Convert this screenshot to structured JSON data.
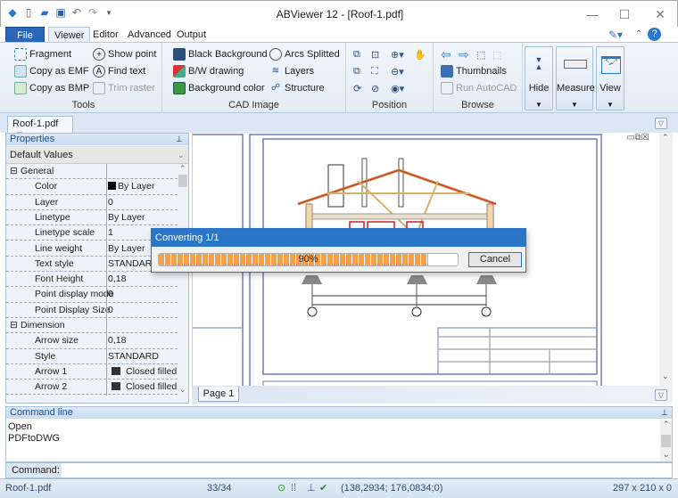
{
  "window": {
    "title": "ABViewer 12 - [Roof-1.pdf]",
    "minimize": "—",
    "maximize": "☐",
    "close": "✕"
  },
  "ribbon_tabs": [
    "File",
    "Viewer",
    "Editor",
    "Advanced",
    "Output"
  ],
  "ribbon": {
    "tools": {
      "label": "Tools",
      "items": [
        "Fragment",
        "Copy as EMF",
        "Copy as BMP",
        "Show point",
        "Find text",
        "Trim raster"
      ]
    },
    "cad_image": {
      "label": "CAD Image",
      "items": [
        "Black Background",
        "B/W drawing",
        "Background color",
        "Arcs Splitted",
        "Layers",
        "Structure"
      ]
    },
    "position": {
      "label": "Position"
    },
    "browse": {
      "label": "Browse",
      "items": [
        "Thumbnails",
        "Run AutoCAD"
      ]
    },
    "big_buttons": [
      "Hide",
      "Measure",
      "View"
    ]
  },
  "document_tab": "Roof-1.pdf",
  "properties": {
    "title": "Properties",
    "combo": "Default Values",
    "rows": [
      {
        "cat": true,
        "name": "General",
        "value": ""
      },
      {
        "name": "Color",
        "value": "By Layer"
      },
      {
        "name": "Layer",
        "value": "0"
      },
      {
        "name": "Linetype",
        "value": "By Layer"
      },
      {
        "name": "Linetype scale",
        "value": "1"
      },
      {
        "name": "Line weight",
        "value": "By Layer"
      },
      {
        "name": "Text style",
        "value": "STANDARD"
      },
      {
        "name": "Font Height",
        "value": "0,18"
      },
      {
        "name": "Point display mode",
        "value": "0"
      },
      {
        "name": "Point Display Size",
        "value": "0"
      },
      {
        "cat": true,
        "name": "Dimension",
        "value": ""
      },
      {
        "name": "Arrow size",
        "value": "0,18"
      },
      {
        "name": "Style",
        "value": "STANDARD"
      },
      {
        "name": "Arrow 1",
        "value": "Closed filled"
      },
      {
        "name": "Arrow 2",
        "value": "Closed filled"
      }
    ]
  },
  "page_tab": "Page 1",
  "dialog": {
    "title": "Converting 1/1",
    "progress_percent": 90,
    "progress_text": "90%",
    "cancel": "Cancel"
  },
  "command_line": {
    "title": "Command line",
    "log": [
      "Open",
      "PDFtoDWG"
    ],
    "prompt": "Command:",
    "value": ""
  },
  "status": {
    "file": "Roof-1.pdf",
    "pages": "33/34",
    "coords": "(138,2934; 176,0834;0)",
    "size": "297 x 210 x 0"
  }
}
